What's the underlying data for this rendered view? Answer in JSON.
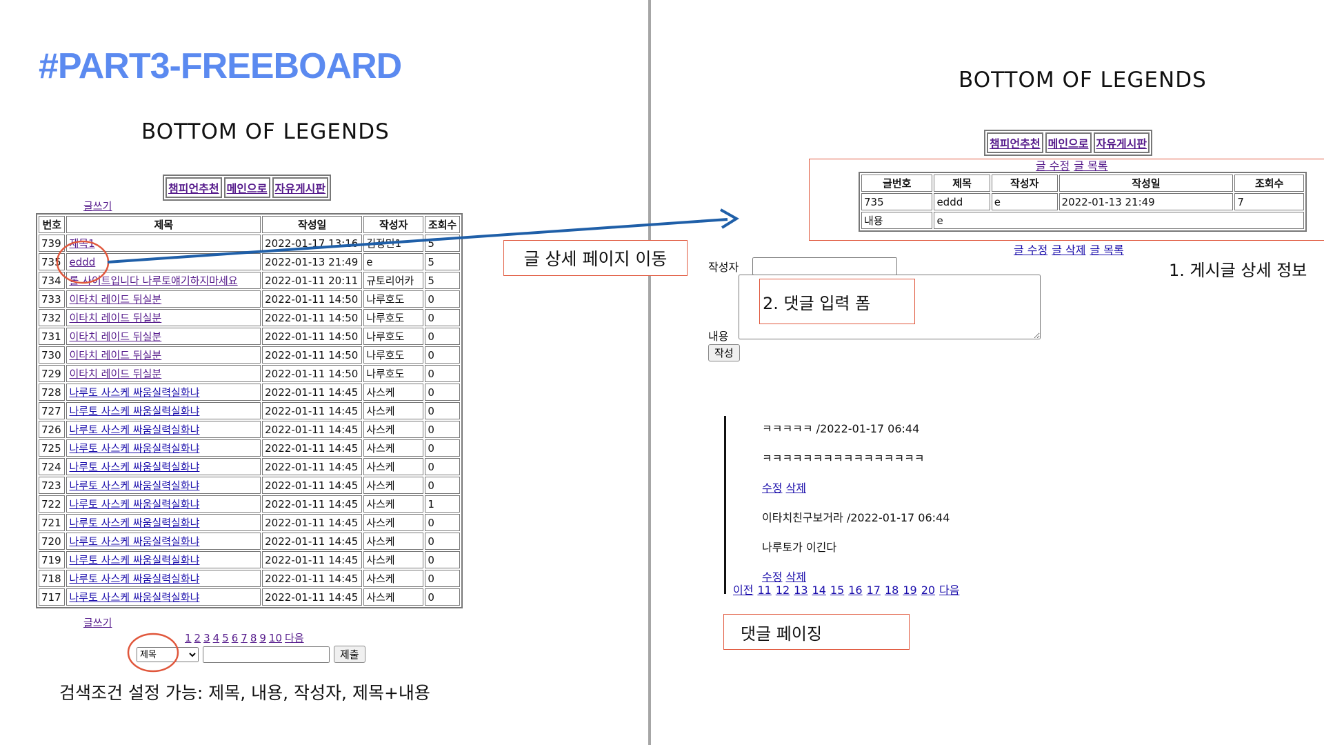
{
  "slide": {
    "title": "#PART3-FREEBOARD"
  },
  "left": {
    "site_title": "BOTTOM OF LEGENDS",
    "nav": [
      "챔피언추천",
      "메인으로",
      "자유게시판"
    ],
    "write_link": "글쓰기",
    "table": {
      "headers": [
        "번호",
        "제목",
        "작성일",
        "작성자",
        "조회수"
      ],
      "rows": [
        [
          "739",
          "제목1",
          "2022-01-17 13:16",
          "김정민1",
          "5"
        ],
        [
          "735",
          "eddd",
          "2022-01-13 21:49",
          "e",
          "5"
        ],
        [
          "734",
          "롤 사이트입니다 나루토얘기하지마세요",
          "2022-01-11 20:11",
          "규토리어카",
          "5"
        ],
        [
          "733",
          "이타치 레이드 뒤실분",
          "2022-01-11 14:50",
          "나루호도",
          "0"
        ],
        [
          "732",
          "이타치 레이드 뒤실분",
          "2022-01-11 14:50",
          "나루호도",
          "0"
        ],
        [
          "731",
          "이타치 레이드 뒤실분",
          "2022-01-11 14:50",
          "나루호도",
          "0"
        ],
        [
          "730",
          "이타치 레이드 뒤실분",
          "2022-01-11 14:50",
          "나루호도",
          "0"
        ],
        [
          "729",
          "이타치 레이드 뒤실분",
          "2022-01-11 14:50",
          "나루호도",
          "0"
        ],
        [
          "728",
          "나루토 사스케 싸움실력실화냐",
          "2022-01-11 14:45",
          "사스케",
          "0"
        ],
        [
          "727",
          "나루토 사스케 싸움실력실화냐",
          "2022-01-11 14:45",
          "사스케",
          "0"
        ],
        [
          "726",
          "나루토 사스케 싸움실력실화냐",
          "2022-01-11 14:45",
          "사스케",
          "0"
        ],
        [
          "725",
          "나루토 사스케 싸움실력실화냐",
          "2022-01-11 14:45",
          "사스케",
          "0"
        ],
        [
          "724",
          "나루토 사스케 싸움실력실화냐",
          "2022-01-11 14:45",
          "사스케",
          "0"
        ],
        [
          "723",
          "나루토 사스케 싸움실력실화냐",
          "2022-01-11 14:45",
          "사스케",
          "0"
        ],
        [
          "722",
          "나루토 사스케 싸움실력실화냐",
          "2022-01-11 14:45",
          "사스케",
          "1"
        ],
        [
          "721",
          "나루토 사스케 싸움실력실화냐",
          "2022-01-11 14:45",
          "사스케",
          "0"
        ],
        [
          "720",
          "나루토 사스케 싸움실력실화냐",
          "2022-01-11 14:45",
          "사스케",
          "0"
        ],
        [
          "719",
          "나루토 사스케 싸움실력실화냐",
          "2022-01-11 14:45",
          "사스케",
          "0"
        ],
        [
          "718",
          "나루토 사스케 싸움실력실화냐",
          "2022-01-11 14:45",
          "사스케",
          "0"
        ],
        [
          "717",
          "나루토 사스케 싸움실력실화냐",
          "2022-01-11 14:45",
          "사스케",
          "0"
        ]
      ]
    },
    "pagination": {
      "pages": [
        "1",
        "2",
        "3",
        "4",
        "5",
        "6",
        "7",
        "8",
        "9",
        "10"
      ],
      "next": "다음"
    },
    "search": {
      "select_value": "제목",
      "input_value": "",
      "submit_label": "제출"
    },
    "search_caption": "검색조건 설정 가능: 제목, 내용, 작성자, 제목+내용",
    "callout_detail_move": "글 상세 페이지 이동"
  },
  "right": {
    "site_title": "BOTTOM OF LEGENDS",
    "nav": [
      "챔피언추천",
      "메인으로",
      "자유게시판"
    ],
    "top_links": [
      "글 수정",
      "글 목록"
    ],
    "detail": {
      "headers": [
        "글번호",
        "제목",
        "작성자",
        "작성일",
        "조회수"
      ],
      "values": [
        "735",
        "eddd",
        "e",
        "2022-01-13 21:49",
        "7"
      ],
      "content_label": "내용",
      "content_value": "e"
    },
    "bottom_links": [
      "글 수정",
      "글 삭제",
      "글 목록"
    ],
    "callout_detail": "1. 게시글 상세 정보",
    "comment_form": {
      "author_label": "작성자",
      "author_value": "",
      "content_label": "내용",
      "submit_label": "작성",
      "callout": "2. 댓글 입력 폼"
    },
    "comments": [
      {
        "meta": "ㅋㅋㅋㅋㅋ /2022-01-17 06:44",
        "body": "ㅋㅋㅋㅋㅋㅋㅋㅋㅋㅋㅋㅋㅋㅋㅋㅋ",
        "edit": "수정",
        "delete": "삭제"
      },
      {
        "meta": "이타치친구보거라 /2022-01-17 06:44",
        "body": "나루토가 이긴다",
        "edit": "수정",
        "delete": "삭제"
      }
    ],
    "comment_pagination": {
      "prev": "이전",
      "pages": [
        "11",
        "12",
        "13",
        "14",
        "15",
        "16",
        "17",
        "18",
        "19",
        "20"
      ],
      "next": "다음"
    },
    "callout_comment_paging": "댓글 페이징"
  },
  "colors": {
    "title_blue": "#5b8af0",
    "callout_red": "#e0573c",
    "arrow_blue": "#1f5fa8",
    "visited_link": "#551a8b",
    "link": "#1a0dab"
  }
}
